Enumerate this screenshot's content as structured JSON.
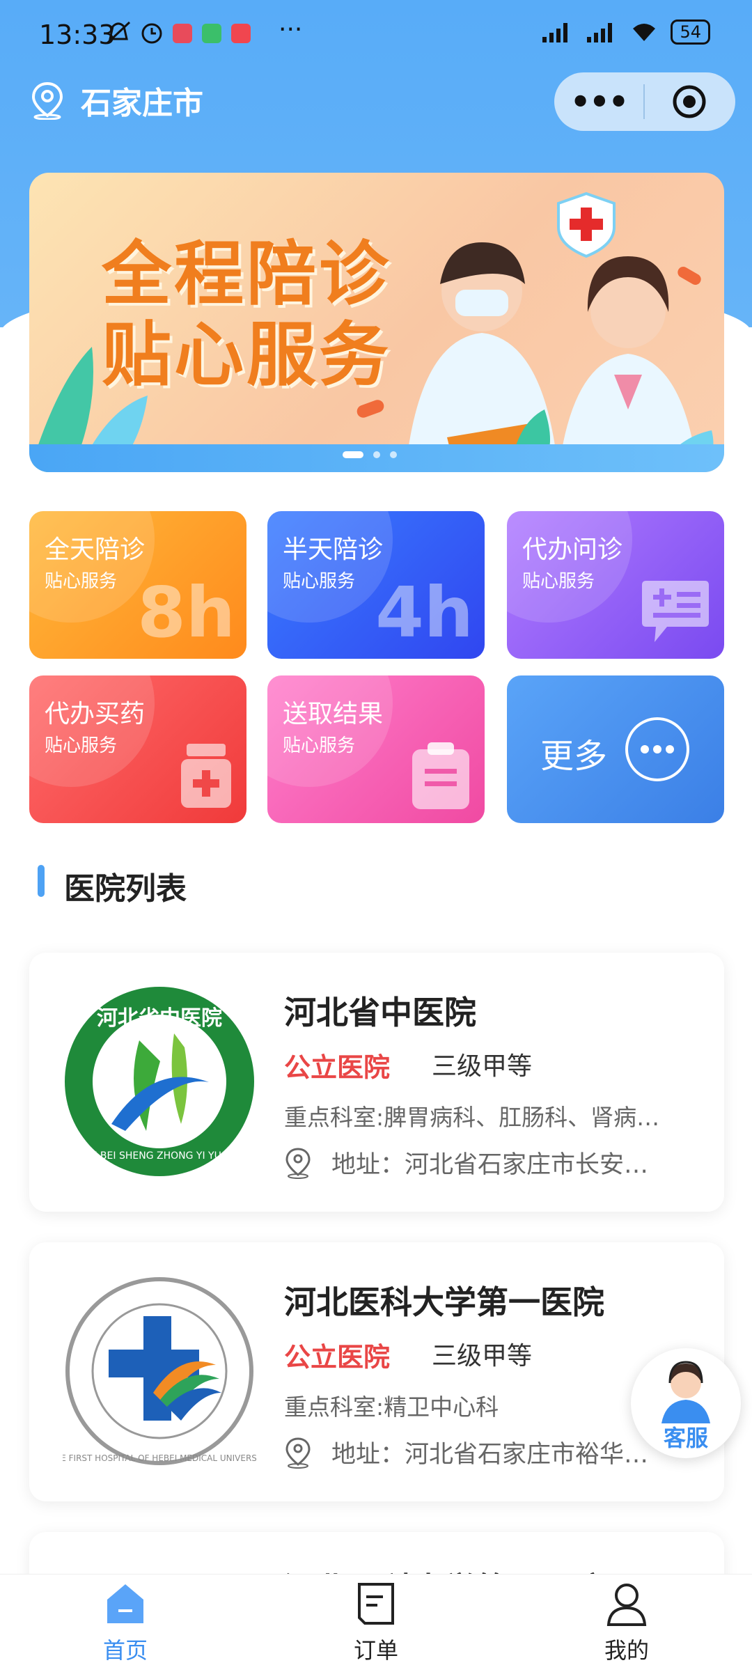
{
  "status_bar": {
    "time": "13:33",
    "battery": "54"
  },
  "nav": {
    "location": "石家庄市",
    "more_dots": "•••"
  },
  "banner": {
    "line1": "全程陪诊",
    "line2": "贴心服务"
  },
  "services": [
    {
      "title": "全天陪诊",
      "sub": "贴心服务",
      "big": "8h"
    },
    {
      "title": "半天陪诊",
      "sub": "贴心服务",
      "big": "4h"
    },
    {
      "title": "代办问诊",
      "sub": "贴心服务"
    },
    {
      "title": "代办买药",
      "sub": "贴心服务"
    },
    {
      "title": "送取结果",
      "sub": "贴心服务"
    },
    {
      "title": "更多"
    }
  ],
  "section": {
    "title": "医院列表"
  },
  "hospitals": [
    {
      "name": "河北省中医院",
      "type": "公立医院",
      "grade": "三级甲等",
      "departments": "重点科室:脾胃病科、肛肠科、肾病…",
      "address": "地址：河北省石家庄市长安…",
      "logo_ring_text": "河北省中医院",
      "logo_latin": "HE BEI SHENG ZHONG YI YUAN"
    },
    {
      "name": "河北医科大学第一医院",
      "type": "公立医院",
      "grade": "三级甲等",
      "departments": "重点科室:精卫中心科",
      "address": "地址：河北省石家庄市裕华…",
      "logo_latin": "THE FIRST HOSPITAL OF HEBEI MEDICAL UNIVERSITY"
    },
    {
      "name": "河北医科大学第二医院"
    }
  ],
  "customer_service": {
    "label": "客服"
  },
  "tabbar": [
    {
      "label": "首页",
      "active": true
    },
    {
      "label": "订单"
    },
    {
      "label": "我的"
    }
  ],
  "colors": {
    "primary": "#3a8ef0",
    "header": "#58acf8",
    "public_tag": "#e94646"
  }
}
